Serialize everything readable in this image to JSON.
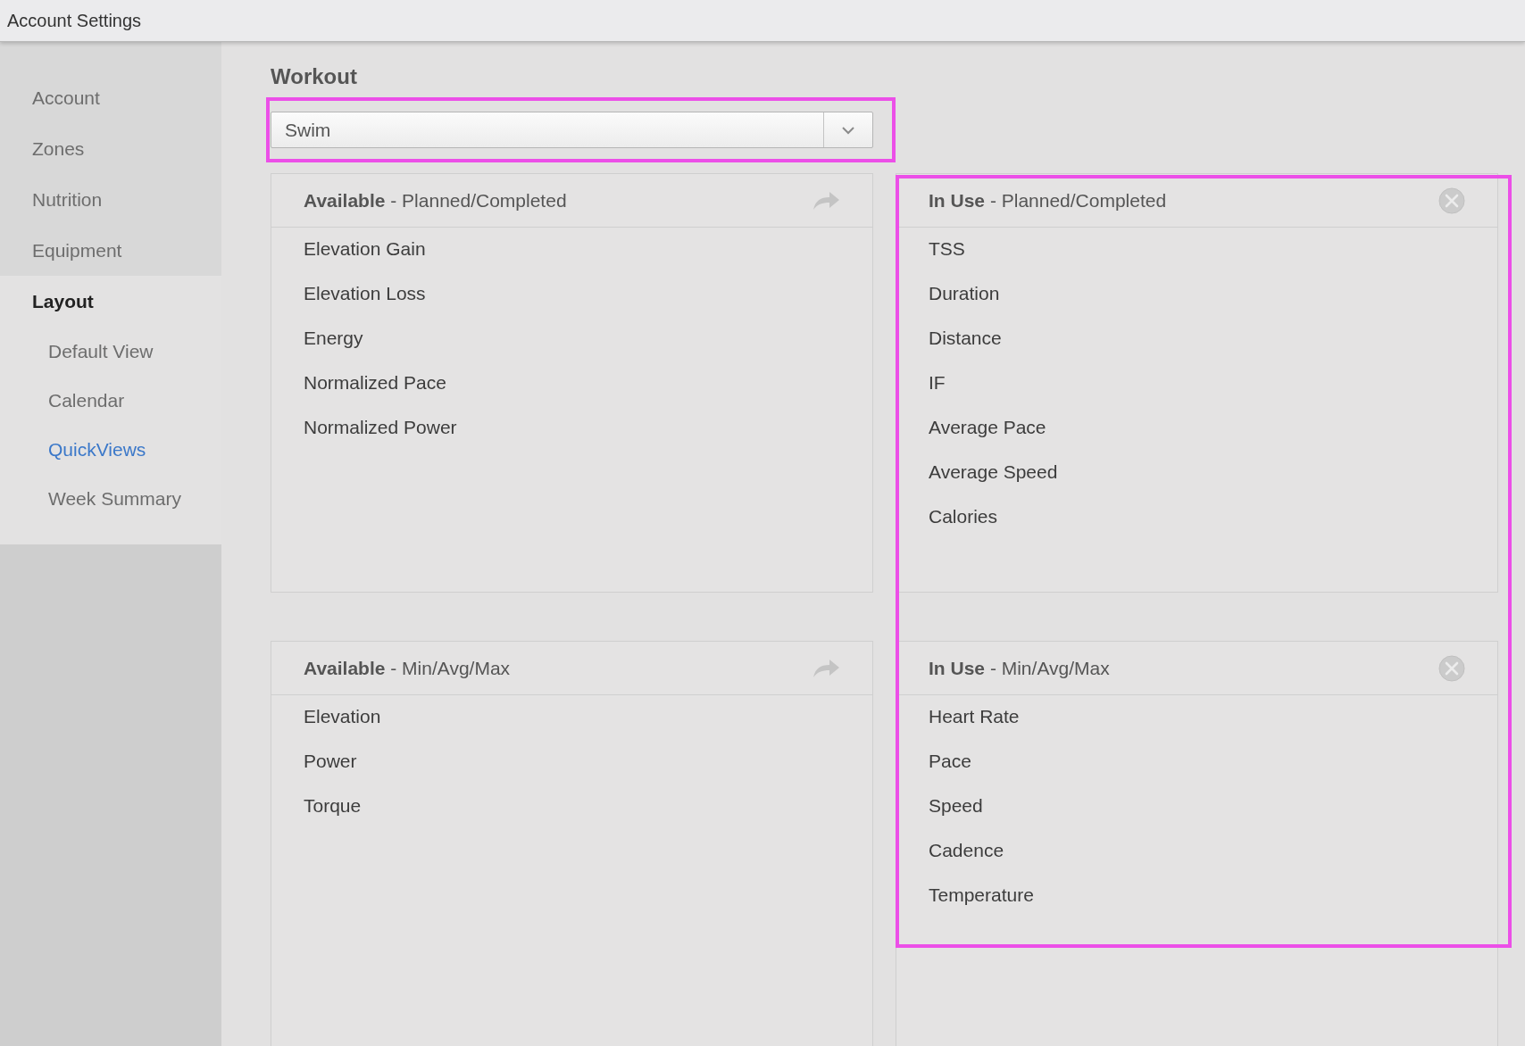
{
  "window": {
    "title": "Account Settings"
  },
  "sidebar": {
    "items": [
      {
        "label": "Account",
        "selected": false
      },
      {
        "label": "Zones",
        "selected": false
      },
      {
        "label": "Nutrition",
        "selected": false
      },
      {
        "label": "Equipment",
        "selected": false
      },
      {
        "label": "Layout",
        "selected": false,
        "expanded": true,
        "children": [
          {
            "label": "Default View",
            "selected": false
          },
          {
            "label": "Calendar",
            "selected": false
          },
          {
            "label": "QuickViews",
            "selected": true
          },
          {
            "label": "Week Summary",
            "selected": false
          }
        ]
      }
    ]
  },
  "workout": {
    "label": "Workout",
    "value": "Swim",
    "highlighted": true
  },
  "available_panels": [
    {
      "title": "Available",
      "subtitle": "- Planned/Completed",
      "items": [
        "Elevation Gain",
        "Elevation Loss",
        "Energy",
        "Normalized Pace",
        "Normalized Power"
      ]
    },
    {
      "title": "Available",
      "subtitle": "- Min/Avg/Max",
      "items": [
        "Elevation",
        "Power",
        "Torque"
      ]
    }
  ],
  "in_use": {
    "highlighted": true,
    "panels": [
      {
        "title": "In Use",
        "subtitle": "- Planned/Completed",
        "items": [
          "TSS",
          "Duration",
          "Distance",
          "IF",
          "Average Pace",
          "Average Speed",
          "Calories"
        ]
      },
      {
        "title": "In Use",
        "subtitle": "- Min/Avg/Max",
        "items": [
          "Heart Rate",
          "Pace",
          "Speed",
          "Cadence",
          "Temperature"
        ]
      }
    ]
  }
}
